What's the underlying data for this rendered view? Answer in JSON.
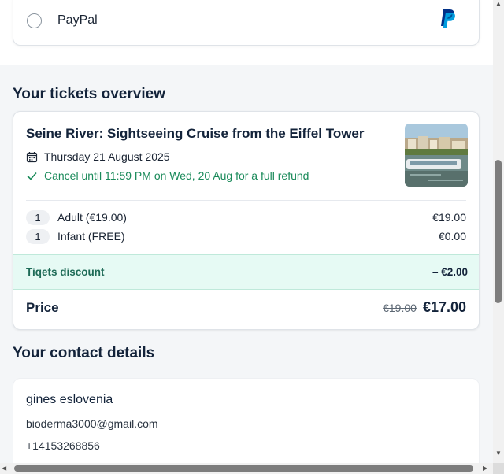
{
  "payment": {
    "option_label": "PayPal",
    "logo_icon": "paypal-logo"
  },
  "tickets_overview": {
    "section_title": "Your tickets overview",
    "tour_title": "Seine River: Sightseeing Cruise from the Eiffel Tower",
    "date_text": "Thursday 21 August 2025",
    "cancel_text": "Cancel until 11:59 PM on Wed, 20 Aug for a full refund",
    "image_icon": "cruise-boat-photo",
    "tickets": [
      {
        "qty": "1",
        "label": "Adult (€19.00)",
        "amount": "€19.00"
      },
      {
        "qty": "1",
        "label": "Infant (FREE)",
        "amount": "€0.00"
      }
    ],
    "discount_label": "Tiqets discount",
    "discount_amount": "– €2.00",
    "price_label": "Price",
    "old_price": "€19.00",
    "new_price": "€17.00"
  },
  "contact": {
    "section_title": "Your contact details",
    "name": "gines eslovenia",
    "email": "bioderma3000@gmail.com",
    "phone": "+14153268856"
  },
  "colors": {
    "brand_navy": "#13233a",
    "success_green": "#1a8a5a",
    "discount_bg": "#e6faf4",
    "paypal_blue": "#003087",
    "paypal_light": "#009cde"
  }
}
